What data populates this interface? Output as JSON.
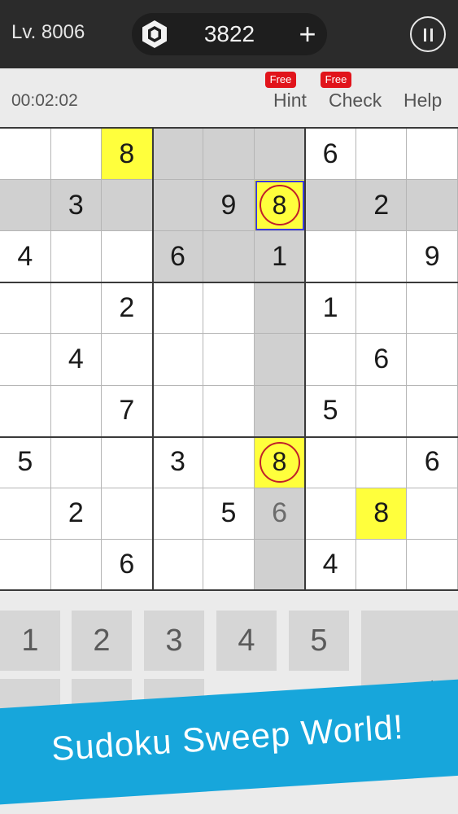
{
  "header": {
    "level": "Lv. 8006",
    "coins": "3822",
    "plus_label": "+",
    "gem_icon": "gem-icon",
    "pause_icon": "pause-icon"
  },
  "toolbar": {
    "timer": "00:02:02",
    "hint_label": "Hint",
    "hint_badge": "Free",
    "check_label": "Check",
    "check_badge": "Free",
    "help_label": "Help"
  },
  "board": {
    "rows": [
      [
        "",
        "",
        "8",
        "",
        "",
        "",
        "6",
        "",
        ""
      ],
      [
        "",
        "3",
        "",
        "",
        "9",
        "8",
        "",
        "2",
        ""
      ],
      [
        "4",
        "",
        "",
        "6",
        "",
        "1",
        "",
        "",
        "9"
      ],
      [
        "",
        "",
        "2",
        "",
        "",
        "",
        "1",
        "",
        ""
      ],
      [
        "",
        "4",
        "",
        "",
        "",
        "",
        "",
        "6",
        ""
      ],
      [
        "",
        "",
        "7",
        "",
        "",
        "",
        "5",
        "",
        ""
      ],
      [
        "5",
        "",
        "",
        "3",
        "",
        "8",
        "",
        "",
        "6"
      ],
      [
        "",
        "2",
        "",
        "",
        "5",
        "6",
        "",
        "8",
        ""
      ],
      [
        "",
        "",
        "6",
        "",
        "",
        "",
        "4",
        "",
        ""
      ]
    ],
    "selected": [
      1,
      5
    ],
    "yellow_cells": [
      [
        0,
        2
      ],
      [
        1,
        5
      ],
      [
        6,
        5
      ],
      [
        7,
        7
      ]
    ],
    "circled_cells": [
      [
        1,
        5
      ],
      [
        6,
        5
      ]
    ],
    "user_entered": [
      [
        7,
        5
      ]
    ],
    "colors": {
      "highlight": "#d0d0d0",
      "match": "#ffff3c",
      "select_border": "#3a3ae0",
      "ring": "#c0202a"
    }
  },
  "pad": {
    "numbers": [
      "1",
      "2",
      "3",
      "4",
      "5"
    ],
    "pencil_icon": "pencil-icon"
  },
  "banner": {
    "text": "Sudoku Sweep World!",
    "color": "#17a6db"
  }
}
